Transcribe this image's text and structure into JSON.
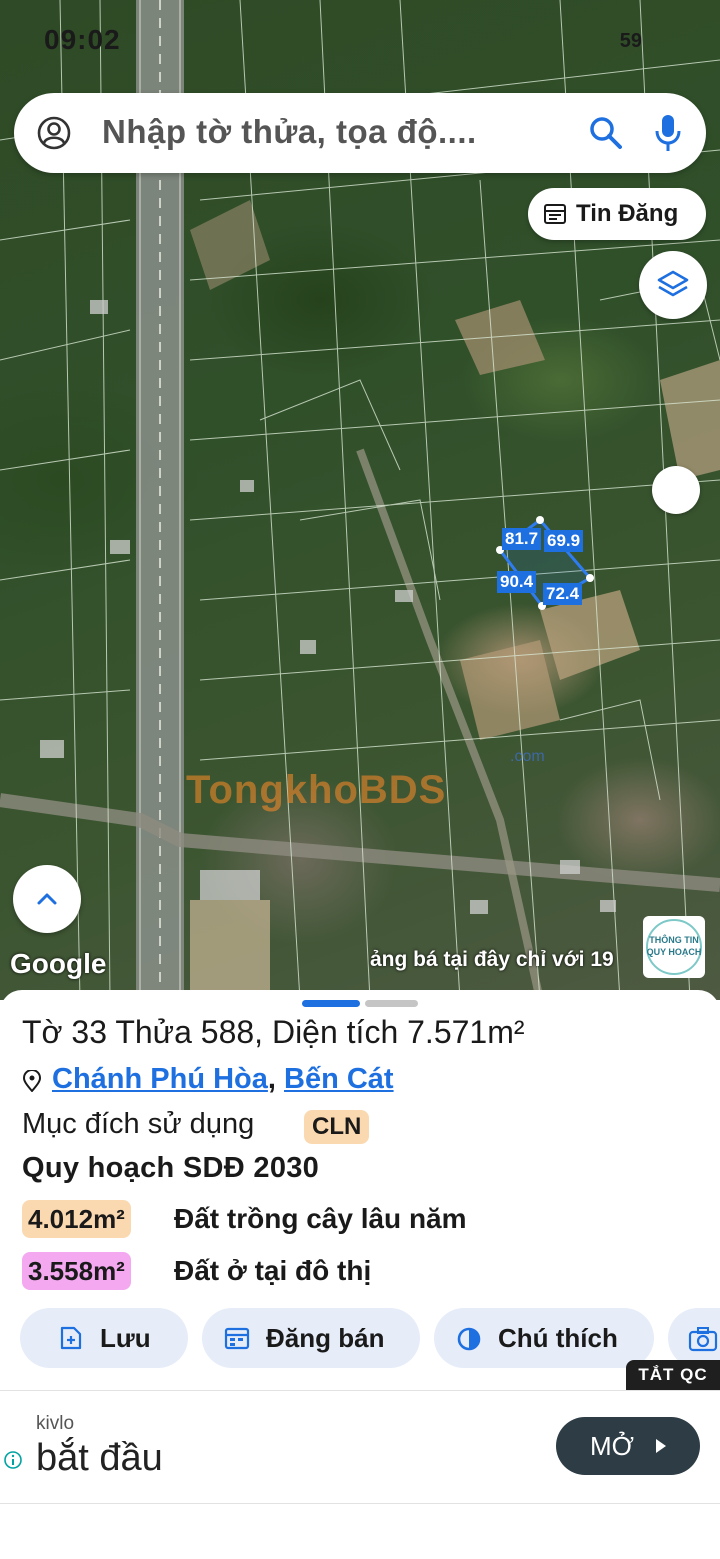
{
  "status_bar": {
    "time": "09:02",
    "right": "59"
  },
  "search": {
    "placeholder": "Nhập tờ thửa, tọa độ....",
    "avatar_icon": "person-icon",
    "search_icon": "search-icon",
    "mic_icon": "mic-icon"
  },
  "map": {
    "tin_dang_label": "Tin Đăng",
    "plot_edges": [
      "81.7",
      "69.9",
      "90.4",
      "72.4"
    ],
    "watermark": "TongkhoBDS",
    "watermark_suffix": ".com",
    "google_label": "Google",
    "ad_ticker": "ảng bá tại đây chỉ với 19",
    "qh_badge_line1": "THÔNG TIN",
    "qh_badge_line2": "QUY HOẠCH"
  },
  "parcel": {
    "title": "Tờ 33 Thửa 588, Diện tích 7.571m²",
    "ward": "Chánh Phú Hòa",
    "separator": ", ",
    "district": "Bến Cát",
    "purpose_label": "Mục đích sử dụng",
    "purpose_code": "CLN",
    "plan_label": "Quy hoạch SDĐ 2030",
    "zones": [
      {
        "area": "4.012m²",
        "desc": "Đất trồng cây lâu năm",
        "color": "#fbd9b0"
      },
      {
        "area": "3.558m²",
        "desc": "Đất ở tại đô thị",
        "color": "#f3a8f0"
      }
    ]
  },
  "actions": [
    {
      "label": "Lưu",
      "icon": "save-icon"
    },
    {
      "label": "Đăng bán",
      "icon": "calendar-icon"
    },
    {
      "label": "Chú thích",
      "icon": "contrast-icon"
    },
    {
      "label": "",
      "icon": "camera-icon"
    }
  ],
  "tat_qc": "TẮT QC",
  "ad": {
    "source": "kivlo",
    "headline": "bắt đầu",
    "button": "MỞ"
  },
  "colors": {
    "accent": "#1e6fe0",
    "action_bg": "#e6edf9",
    "ad_button": "#2e3c45"
  }
}
